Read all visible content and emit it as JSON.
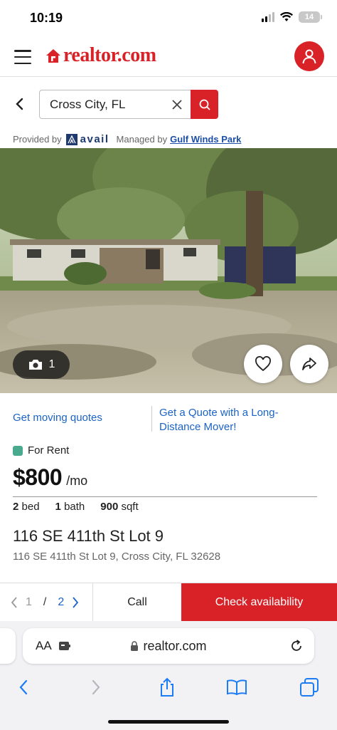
{
  "status_bar": {
    "time": "10:19",
    "battery": "14"
  },
  "header": {
    "logo": "realtor.com",
    "menu_icon": "hamburger-icon",
    "account_icon": "user-icon"
  },
  "search": {
    "value": "Cross City, FL",
    "clear_icon": "close-icon",
    "search_icon": "search-icon",
    "back_icon": "chevron-left-icon"
  },
  "provider": {
    "provided_by_label": "Provided by",
    "provider_name": "avail",
    "managed_by_label": "Managed by",
    "manager_name": "Gulf Winds Park"
  },
  "photo": {
    "count": "1",
    "camera_icon": "camera-icon",
    "favorite_icon": "heart-icon",
    "share_icon": "share-arrow-icon"
  },
  "quotes": {
    "moving_link": "Get moving quotes",
    "long_distance_link_line1": "Get a Quote with a Long-",
    "long_distance_link_line2": "Distance Mover!"
  },
  "listing": {
    "status": "For Rent",
    "status_color": "#4aaa8e",
    "price": "$800",
    "price_unit": "/mo",
    "beds_value": "2",
    "beds_label": "bed",
    "baths_value": "1",
    "baths_label": "bath",
    "sqft_value": "900",
    "sqft_label": "sqft",
    "address_line1": "116 SE 411th St Lot 9",
    "address_line2": "116 SE 411th St Lot 9, Cross City, FL 32628"
  },
  "bottom_bar": {
    "current_page": "1",
    "separator": "/",
    "total_pages": "2",
    "call_label": "Call",
    "check_label": "Check availability"
  },
  "browser": {
    "text_size_label": "AA",
    "url": "realtor.com",
    "reload_icon": "reload-icon",
    "toolbar": [
      "back-icon",
      "forward-icon",
      "share-icon",
      "bookmarks-icon",
      "tabs-icon"
    ]
  },
  "colors": {
    "brand": "#d92228",
    "link": "#1b63c6",
    "avail": "#1f3a6e"
  }
}
